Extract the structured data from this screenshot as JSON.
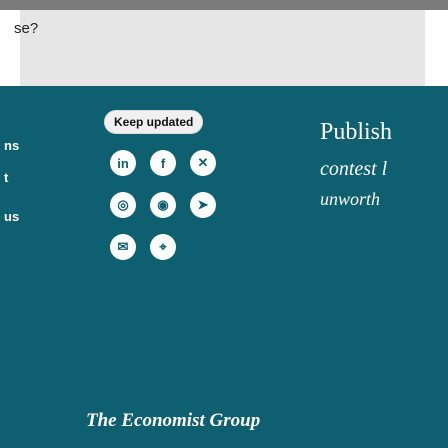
{
  "top_text": "se?",
  "left_labels": [
    "ns",
    "t",
    "us"
  ],
  "keep": {
    "label": "Keep updated"
  },
  "social_icons": [
    "linkedin-icon",
    "facebook-icon",
    "x-icon",
    "instagram-icon",
    "whatsapp-icon",
    "telegram-icon",
    "email-icon",
    "location-icon"
  ],
  "right_lines": [
    "Publish",
    "contest l",
    "unworth"
  ],
  "brand": "The Economist Group",
  "colors": {
    "teal": "#0e5f6f"
  }
}
